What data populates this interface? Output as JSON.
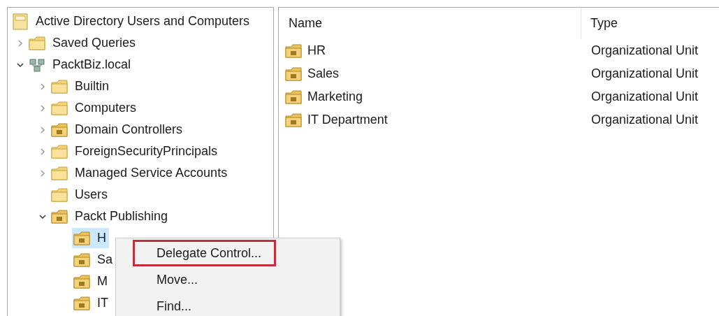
{
  "tree": {
    "label": "Active Directory Users and Computers",
    "kind": "root",
    "selected": false,
    "children": [
      {
        "label": "Saved Queries",
        "kind": "folder",
        "expanded": false,
        "selected": false
      },
      {
        "label": "PacktBiz.local",
        "kind": "domain",
        "expanded": true,
        "selected": false,
        "children": [
          {
            "label": "Builtin",
            "kind": "folder",
            "expanded": false,
            "selected": false
          },
          {
            "label": "Computers",
            "kind": "folder",
            "expanded": false,
            "selected": false
          },
          {
            "label": "Domain Controllers",
            "kind": "ou",
            "expanded": false,
            "selected": false
          },
          {
            "label": "ForeignSecurityPrincipals",
            "kind": "folder",
            "expanded": false,
            "selected": false
          },
          {
            "label": "Managed Service Accounts",
            "kind": "folder",
            "expanded": false,
            "selected": false
          },
          {
            "label": "Users",
            "kind": "folder",
            "selected": false
          },
          {
            "label": "Packt Publishing",
            "kind": "ou",
            "expanded": true,
            "selected": false,
            "children": [
              {
                "label": "H",
                "kind": "ou",
                "selected": true
              },
              {
                "label": "Sa",
                "kind": "ou",
                "selected": false
              },
              {
                "label": "M",
                "kind": "ou",
                "selected": false
              },
              {
                "label": "IT",
                "kind": "ou",
                "selected": false
              }
            ]
          }
        ]
      }
    ]
  },
  "list": {
    "columns": [
      "Name",
      "Type"
    ],
    "rows": [
      {
        "name": "HR",
        "type": "Organizational Unit",
        "kind": "ou"
      },
      {
        "name": "Sales",
        "type": "Organizational Unit",
        "kind": "ou"
      },
      {
        "name": "Marketing",
        "type": "Organizational Unit",
        "kind": "ou"
      },
      {
        "name": "IT Department",
        "type": "Organizational Unit",
        "kind": "ou"
      }
    ]
  },
  "context_menu": {
    "items": [
      {
        "label": "Delegate Control...",
        "outlined": true
      },
      {
        "label": "Move...",
        "outlined": false
      },
      {
        "label": "Find...",
        "outlined": false
      }
    ]
  }
}
